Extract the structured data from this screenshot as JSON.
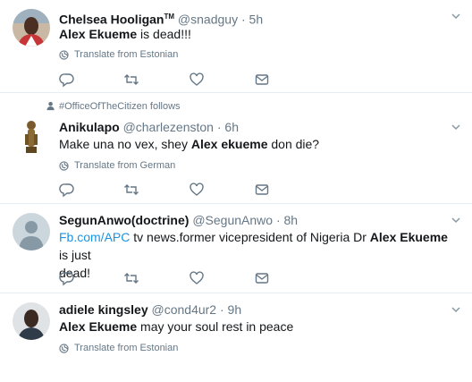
{
  "tweets": [
    {
      "name": "Chelsea Hooligan",
      "name_tm": "TM",
      "handle": "@snadguy",
      "sep": "·",
      "time": "5h",
      "body_bold": "Alex Ekueme",
      "body_rest": " is dead!!!",
      "translate": "Translate from Estonian"
    },
    {
      "follows": "#OfficeOfTheCitizen follows",
      "name": "Anikulapo",
      "handle": "@charlezenston",
      "sep": "·",
      "time": "6h",
      "body_pre": "Make una no vex, shey ",
      "body_bold": "Alex ekueme",
      "body_rest": " don die?",
      "translate": "Translate from German"
    },
    {
      "name": "SegunAnwo(doctrine)",
      "handle": "@SegunAnwo",
      "sep": "·",
      "time": "8h",
      "link": "Fb.com/APC",
      "body_pre": " tv news.former vicepresident of Nigeria Dr ",
      "body_bold": "Alex Ekueme",
      "body_rest": " is just",
      "body_line2": "dead!"
    },
    {
      "name": "adiele kingsley",
      "handle": "@cond4ur2",
      "sep": "·",
      "time": "9h",
      "body_bold": "Alex Ekueme",
      "body_rest": " may your soul rest in peace",
      "translate": "Translate from Estonian"
    }
  ],
  "icons": {
    "reply": "reply-icon",
    "retweet": "retweet-icon",
    "like": "like-icon",
    "dm": "direct-message-icon",
    "globe": "globe-icon",
    "caret": "chevron-down-icon",
    "follow": "user-follow-icon"
  },
  "colors": {
    "text": "#14171a",
    "secondary": "#657786",
    "link": "#1b95e0",
    "divider": "#e6ecf0"
  }
}
